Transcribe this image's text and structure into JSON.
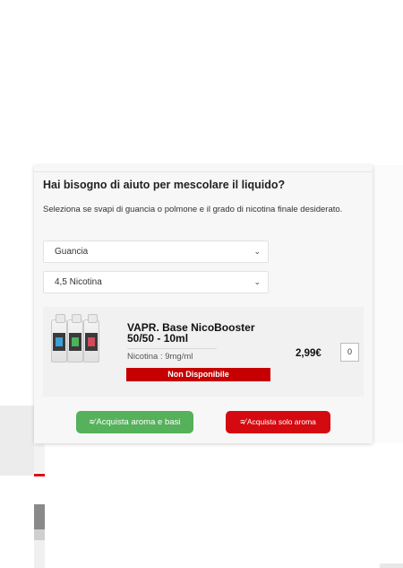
{
  "panel": {
    "title": "Hai bisogno di aiuto per mescolare il liquido?",
    "description": "Seleziona se svapi di guancia o polmone e il grado di nicotina finale desiderato.",
    "select_type": {
      "value": "Guancia"
    },
    "select_nicotine": {
      "value": "4,5 Nicotina"
    }
  },
  "product": {
    "name": "VAPR. Base NicoBooster 50/50 - 10ml",
    "nicotine": "Nicotina : 9mg/ml",
    "status": "Non Disponibile",
    "price": "2,99€",
    "quantity": "0",
    "bottle_colors": [
      "#3aa0d8",
      "#4bb45a",
      "#d04a5a"
    ]
  },
  "actions": {
    "buy_with_bases": "Acquista aroma e basi",
    "buy_aroma_only": "Acquista solo aroma",
    "cart_icon": "cart-icon"
  },
  "colors": {
    "green_button": "#55b15a",
    "red_button": "#d40a10",
    "status_badge": "#c60000"
  }
}
